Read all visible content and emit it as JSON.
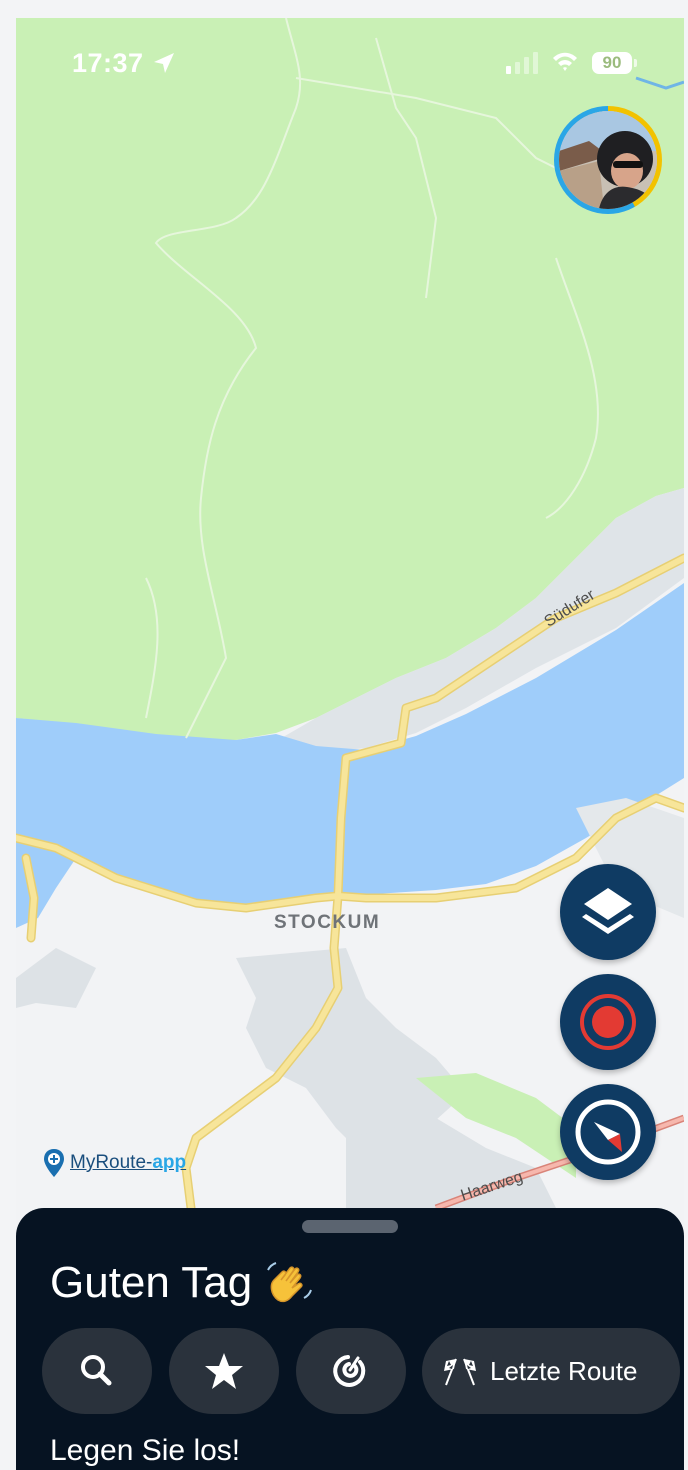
{
  "status_bar": {
    "time": "17:37",
    "battery": "90"
  },
  "map": {
    "place_label": "STOCKUM",
    "roads": [
      "Südufer",
      "Haarweg"
    ],
    "brand": {
      "name": "MyRoute-",
      "accent": "app"
    },
    "colors": {
      "forest": "#c9f0b5",
      "water": "#9fcdfa",
      "road": "#f7e59a",
      "urban": "#dde2e6"
    }
  },
  "fabs": [
    {
      "name": "layers",
      "icon": "layers-icon"
    },
    {
      "name": "record",
      "icon": "record-icon"
    },
    {
      "name": "compass",
      "icon": "compass-icon"
    }
  ],
  "sheet": {
    "greeting": "Guten Tag",
    "greeting_icon": "waving-hand-icon",
    "chips": [
      {
        "icon": "search-icon"
      },
      {
        "icon": "star-icon"
      },
      {
        "icon": "target-icon"
      },
      {
        "icon": "checkered-flags-icon",
        "label": "Letzte Route"
      }
    ],
    "subheading": "Legen Sie los!"
  }
}
